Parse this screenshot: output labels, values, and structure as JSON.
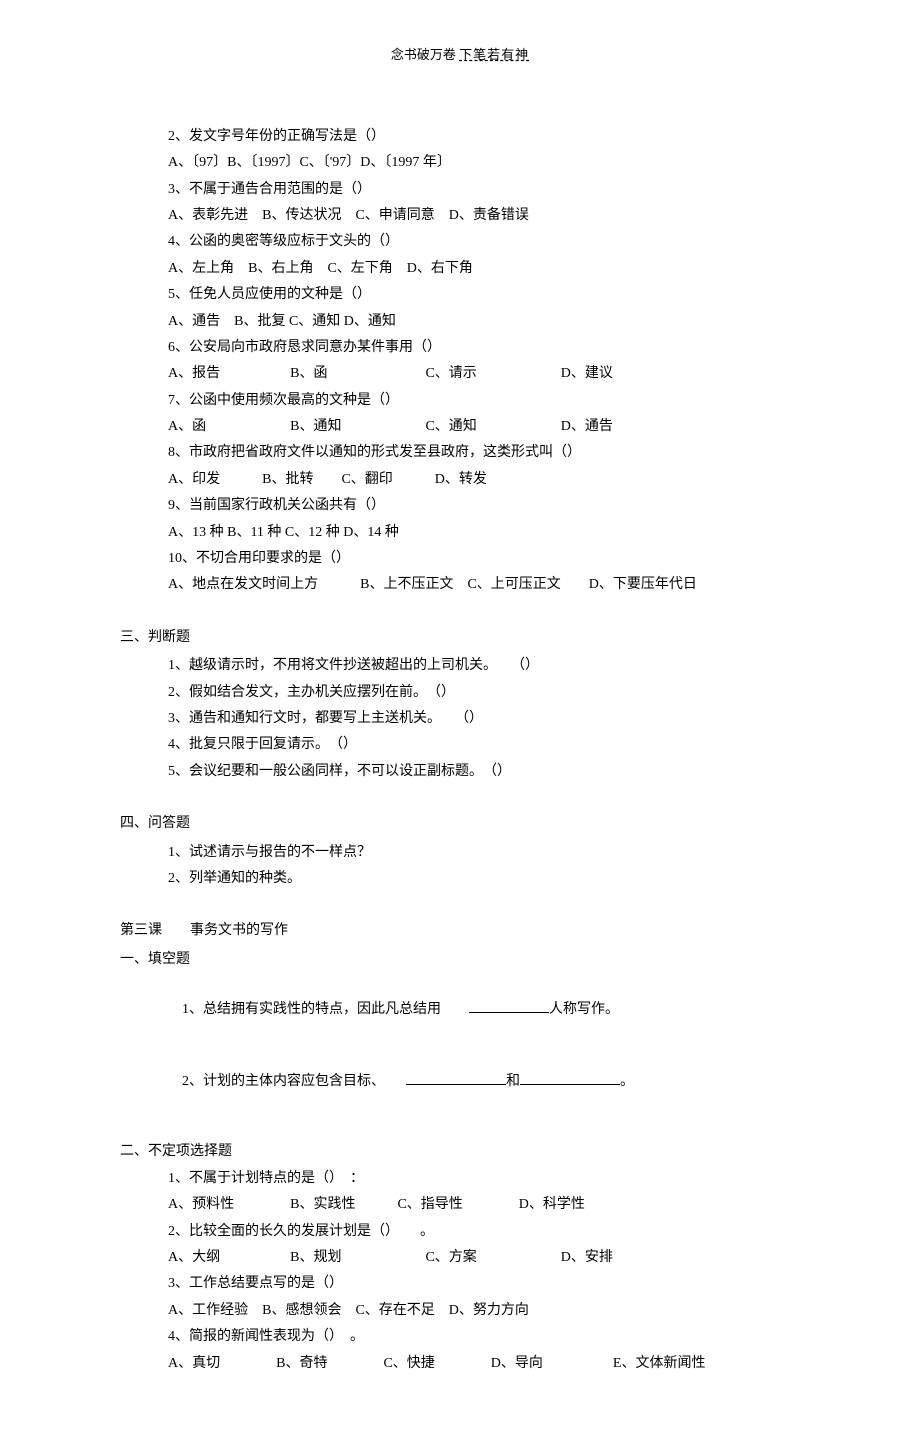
{
  "header": {
    "left": "念书破万卷",
    "right": "下笔若有神"
  },
  "blockA": {
    "q2": {
      "text": "2、发文字号年份的正确写法是（）",
      "opts": "A、〔97〕B、〔1997〕C、〔'97〕D、〔1997 年〕"
    },
    "q3": {
      "text": "3、不属于通告合用范围的是（）",
      "opts": "A、表彰先进　B、传达状况　C、申请同意　D、责备错误"
    },
    "q4": {
      "text": "4、公函的奥密等级应标于文头的（）",
      "opts": "A、左上角　B、右上角　C、左下角　D、右下角"
    },
    "q5": {
      "text": "5、任免人员应使用的文种是（）",
      "opts": "A、通告　B、批复 C、通知 D、通知"
    },
    "q6": {
      "text": "6、公安局向市政府恳求同意办某件事用（）",
      "opts": "A、报告　　　　　B、函　　　　　　　C、请示　　　　　　D、建议"
    },
    "q7": {
      "text": "7、公函中使用频次最高的文种是（）",
      "opts": "A、函　　　　　　B、通知　　　　　　C、通知　　　　　　D、通告"
    },
    "q8": {
      "text": "8、市政府把省政府文件以通知的形式发至县政府，这类形式叫（）",
      "opts": "A、印发　　　B、批转　　C、翻印　　　D、转发"
    },
    "q9": {
      "text": "9、当前国家行政机关公函共有（）",
      "opts": "A、13 种 B、11 种 C、12 种 D、14 种"
    },
    "q10": {
      "text": "10、不切合用印要求的是（）",
      "opts": "A、地点在发文时间上方　　　B、上不压正文　C、上可压正文　　D、下要压年代日"
    }
  },
  "sec3": {
    "title": "三、判断题",
    "items": {
      "i1": "1、越级请示时，不用将文件抄送被超出的上司机关。　　（）",
      "i2": "2、假如结合发文，主办机关应摆列在前。　（）",
      "i3": "3、通告和通知行文时，都要写上主送机关。　　（）",
      "i4": "4、批复只限于回复请示。　（）",
      "i5": "5、会议纪要和一般公函同样，不可以设正副标题。　（）"
    }
  },
  "sec4": {
    "title": "四、问答题",
    "items": {
      "i1": "1、试述请示与报告的不一样点？",
      "i2": "2、列举通知的种类。"
    }
  },
  "lesson3": {
    "title": "第三课　　事务文书的写作",
    "fill": {
      "title": "一、填空题",
      "i1a": "1、总结拥有实践性的特点，因此凡总结用　　",
      "i1b": "人称写作。",
      "i2a": "2、计划的主体内容应包含目标、　　",
      "i2b": "和",
      "i2c": "。"
    },
    "choice": {
      "title": "二、不定项选择题",
      "q1": {
        "text": "1、不属于计划特点的是（）　：",
        "opts": "A、预料性　　　　B、实践性　　　C、指导性　　　　D、科学性"
      },
      "q2": {
        "text": "2、比较全面的长久的发展计划是（）　　。",
        "opts": "A、大纲　　　　　B、规划　　　　　　C、方案　　　　　　D、安排"
      },
      "q3": {
        "text": "3、工作总结要点写的是（）",
        "opts": "A、工作经验　B、感想领会　C、存在不足　D、努力方向"
      },
      "q4": {
        "text": "4、简报的新闻性表现为（）　。",
        "opts": "A、真切　　　　B、奇特　　　　C、快捷　　　　D、导向　　　　　E、文体新闻性"
      }
    }
  }
}
